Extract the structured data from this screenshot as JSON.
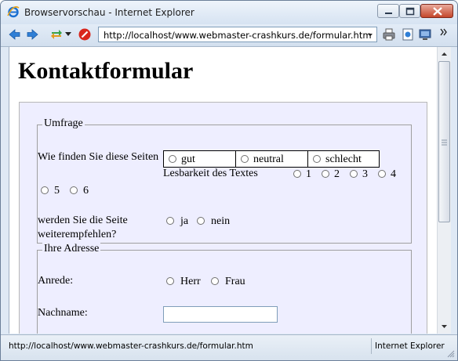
{
  "window": {
    "title": "Browservorschau - Internet Explorer"
  },
  "addressbar": {
    "url": "http://localhost/www.webmaster-crashkurs.de/formular.htm"
  },
  "statusbar": {
    "text": "http://localhost/www.webmaster-crashkurs.de/formular.htm",
    "zone": "Internet Explorer"
  },
  "page": {
    "title": "Kontaktformular",
    "umfrage": {
      "legend": "Umfrage",
      "q1_label": "Wie finden Sie diese Seiten",
      "q1_options": [
        "gut",
        "neutral",
        "schlecht"
      ],
      "q2_label": "Lesbarkeit des Textes",
      "q2_options": [
        "1",
        "2",
        "3",
        "4",
        "5",
        "6"
      ],
      "q3_label": "werden Sie die Seite weiterempfehlen?",
      "q3_options": [
        "ja",
        "nein"
      ]
    },
    "adresse": {
      "legend": "Ihre Adresse",
      "anrede_label": "Anrede:",
      "anrede_options": [
        "Herr",
        "Frau"
      ],
      "nachname_label": "Nachname:",
      "nachname_value": ""
    }
  }
}
